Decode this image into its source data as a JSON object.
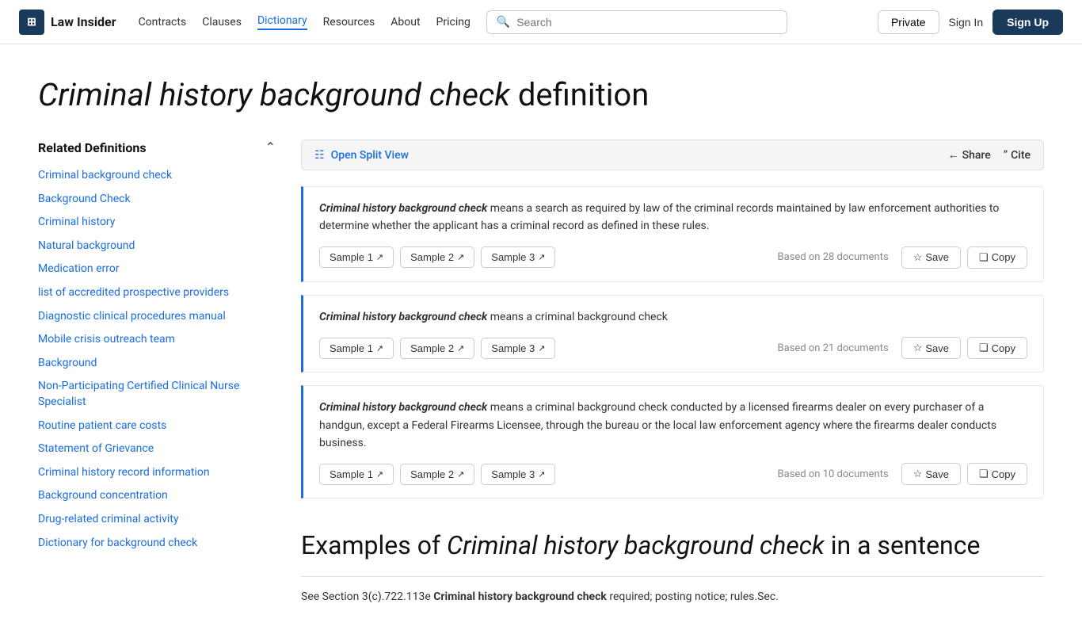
{
  "nav": {
    "logo_text": "Law Insider",
    "logo_icon": "⊞",
    "links": [
      {
        "label": "Contracts",
        "href": "#",
        "active": false
      },
      {
        "label": "Clauses",
        "href": "#",
        "active": false
      },
      {
        "label": "Dictionary",
        "href": "#",
        "active": true
      },
      {
        "label": "Resources",
        "href": "#",
        "active": false
      },
      {
        "label": "About",
        "href": "#",
        "active": false
      },
      {
        "label": "Pricing",
        "href": "#",
        "active": false
      }
    ],
    "search_placeholder": "Search",
    "btn_private": "Private",
    "btn_signin": "Sign In",
    "btn_signup": "Sign Up"
  },
  "page_title_italic": "Criminal history background check",
  "page_title_rest": " definition",
  "sidebar": {
    "title": "Related Definitions",
    "items": [
      "Criminal background check",
      "Background Check",
      "Criminal history",
      "Natural background",
      "Medication error",
      "list of accredited prospective providers",
      "Diagnostic clinical procedures manual",
      "Mobile crisis outreach team",
      "Background",
      "Non-Participating Certified Clinical Nurse Specialist",
      "Routine patient care costs",
      "Statement of Grievance",
      "Criminal history record information",
      "Background concentration",
      "Drug-related criminal activity",
      "Dictionary for background check"
    ]
  },
  "split_view": {
    "label": "Open Split View",
    "share_label": "Share",
    "cite_label": "Cite"
  },
  "definitions": [
    {
      "term": "Criminal history background check",
      "text": " means a search as required by law of the criminal records maintained by law enforcement authorities to determine whether the applicant has a criminal record as defined in these rules.",
      "samples": [
        "Sample 1",
        "Sample 2",
        "Sample 3"
      ],
      "doc_count": "Based on 28 documents",
      "save_label": "Save",
      "copy_label": "Copy"
    },
    {
      "term": "Criminal history background check",
      "text": " means a criminal background check",
      "samples": [
        "Sample 1",
        "Sample 2",
        "Sample 3"
      ],
      "doc_count": "Based on 21 documents",
      "save_label": "Save",
      "copy_label": "Copy"
    },
    {
      "term": "Criminal history background check",
      "text": " means a criminal background check conducted by a licensed firearms dealer on every purchaser of a handgun, except a Federal Firearms Licensee, through the bureau or the local law enforcement agency where the firearms dealer conducts business.",
      "samples": [
        "Sample 1",
        "Sample 2",
        "Sample 3"
      ],
      "doc_count": "Based on 10 documents",
      "save_label": "Save",
      "copy_label": "Copy"
    }
  ],
  "examples": {
    "prefix": "Examples of ",
    "term_italic": "Criminal history background check",
    "suffix": " in a sentence",
    "items": [
      {
        "text_before": "See Section 3(c).722.113e ",
        "bold": "Criminal history background check",
        "text_after": " required; posting notice; rules.Sec."
      }
    ]
  }
}
